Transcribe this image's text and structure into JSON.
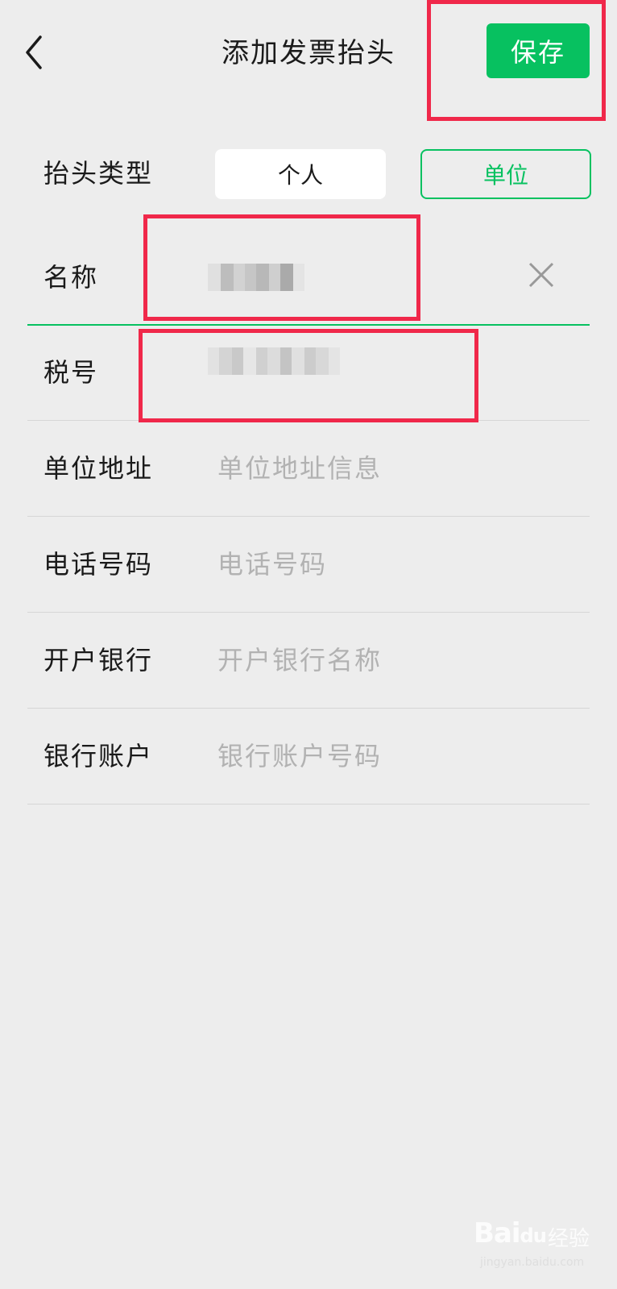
{
  "nav": {
    "title": "添加发票抬头",
    "save_label": "保存"
  },
  "form": {
    "type": {
      "label": "抬头类型",
      "options": [
        "个人",
        "单位"
      ],
      "selected": "单位"
    },
    "name": {
      "label": "名称"
    },
    "tax_id": {
      "label": "税号"
    },
    "address": {
      "label": "单位地址",
      "placeholder": "单位地址信息"
    },
    "phone": {
      "label": "电话号码",
      "placeholder": "电话号码"
    },
    "bank": {
      "label": "开户银行",
      "placeholder": "开户银行名称"
    },
    "account": {
      "label": "银行账户",
      "placeholder": "银行账户号码"
    }
  },
  "colors": {
    "accent": "#07c160",
    "highlight": "#f0284a",
    "background": "#ededed"
  },
  "watermark": {
    "text": "Bai",
    "text2": "du",
    "cn": "经验",
    "url": "jingyan.baidu.com"
  }
}
